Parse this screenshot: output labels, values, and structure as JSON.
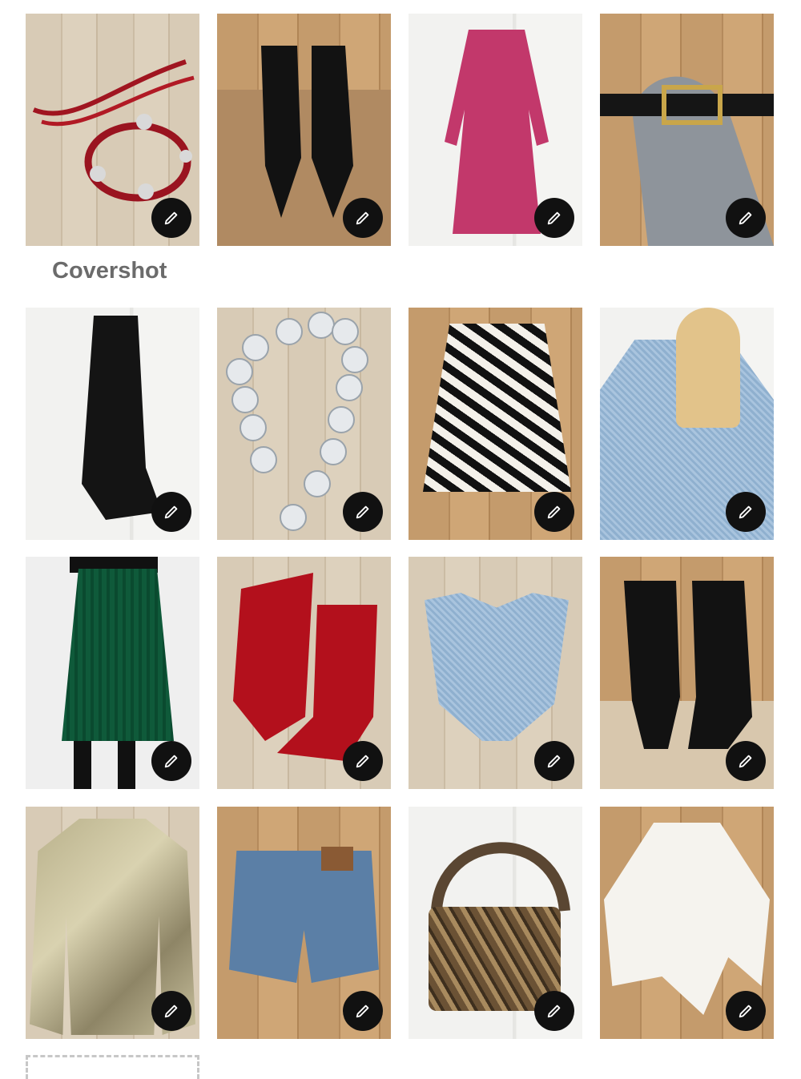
{
  "covershot_label": "Covershot",
  "rows": [
    {
      "items": [
        {
          "name": "red-concho-belt",
          "bg": "wood"
        },
        {
          "name": "black-studded-boots",
          "bg": "wood-warm"
        },
        {
          "name": "pink-print-dress",
          "bg": "wall"
        },
        {
          "name": "black-gold-buckle-belt",
          "bg": "wood-warm"
        }
      ]
    },
    {
      "items": [
        {
          "name": "black-satin-slip-dress",
          "bg": "wall"
        },
        {
          "name": "silver-concho-belt",
          "bg": "wood"
        },
        {
          "name": "zebra-print-skirt",
          "bg": "wood-warm"
        },
        {
          "name": "denim-fringe-jacket",
          "bg": "wall"
        }
      ]
    },
    {
      "items": [
        {
          "name": "green-pleated-skirt",
          "bg": "wall"
        },
        {
          "name": "red-cowboy-boots",
          "bg": "wood"
        },
        {
          "name": "denim-bustier-top",
          "bg": "wood"
        },
        {
          "name": "black-suede-boots",
          "bg": "wood-warm"
        }
      ]
    },
    {
      "items": [
        {
          "name": "metallic-gold-jacket",
          "bg": "wood"
        },
        {
          "name": "denim-cutoff-shorts",
          "bg": "wood-warm"
        },
        {
          "name": "snakeskin-shoulder-bag",
          "bg": "wall"
        },
        {
          "name": "white-eyelet-top",
          "bg": "wood-warm"
        }
      ]
    }
  ],
  "edit_icon": "pencil-icon",
  "colors": {
    "label": "#6b6b6b",
    "button": "#111111"
  }
}
